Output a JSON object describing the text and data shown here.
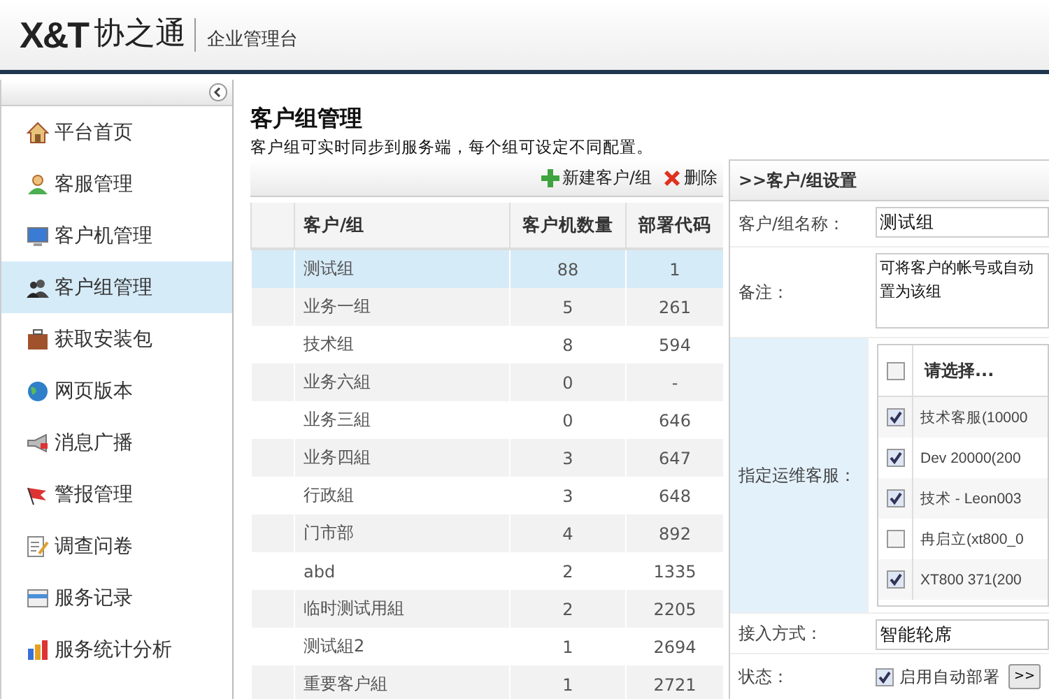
{
  "header": {
    "logo": "X&T",
    "logo_cn": "协之通",
    "subtitle": "企业管理台"
  },
  "sidebar": {
    "items": [
      {
        "label": "平台首页",
        "selected": false
      },
      {
        "label": "客服管理",
        "selected": false
      },
      {
        "label": "客户机管理",
        "selected": false
      },
      {
        "label": "客户组管理",
        "selected": true
      },
      {
        "label": "获取安装包",
        "selected": false
      },
      {
        "label": "网页版本",
        "selected": false
      },
      {
        "label": "消息广播",
        "selected": false
      },
      {
        "label": "警报管理",
        "selected": false
      },
      {
        "label": "调查问卷",
        "selected": false
      },
      {
        "label": "服务记录",
        "selected": false
      },
      {
        "label": "服务统计分析",
        "selected": false
      }
    ]
  },
  "main": {
    "title": "客户组管理",
    "description": "客户组可实时同步到服务端，每个组可设定不同配置。",
    "toolbar": [
      {
        "kind": "add",
        "label": "新建客户/组"
      },
      {
        "kind": "delete",
        "label": "删除"
      }
    ],
    "table": {
      "columns": [
        "客户/组",
        "客户机数量",
        "部署代码"
      ],
      "rows": [
        {
          "cells": [
            "测试组",
            "88",
            "1"
          ],
          "selected": true
        },
        {
          "cells": [
            "业务一组",
            "5",
            "261"
          ],
          "selected": false
        },
        {
          "cells": [
            "技术组",
            "8",
            "594"
          ],
          "selected": false
        },
        {
          "cells": [
            "业务六組",
            "0",
            "-"
          ],
          "selected": false
        },
        {
          "cells": [
            "业务三組",
            "0",
            "646"
          ],
          "selected": false
        },
        {
          "cells": [
            "业务四組",
            "3",
            "647"
          ],
          "selected": false
        },
        {
          "cells": [
            "行政組",
            "3",
            "648"
          ],
          "selected": false
        },
        {
          "cells": [
            "门市部",
            "4",
            "892"
          ],
          "selected": false
        },
        {
          "cells": [
            "abd",
            "2",
            "1335"
          ],
          "selected": false
        },
        {
          "cells": [
            "临时测试用組",
            "2",
            "2205"
          ],
          "selected": false
        },
        {
          "cells": [
            "测试組2",
            "1",
            "2694"
          ],
          "selected": false
        },
        {
          "cells": [
            "重要客户組",
            "1",
            "2721"
          ],
          "selected": false
        }
      ]
    }
  },
  "settings": {
    "title": ">>客户/组设置",
    "name_label": "客户/组名称：",
    "name_value": "测试组",
    "remark_label": "备注：",
    "remark_lines": [
      "可将客户的帐号或自动",
      "置为该组"
    ],
    "assign_label": "指定运维客服：",
    "select_all": {
      "label": "请选择...",
      "checked": false
    },
    "agents": [
      {
        "label": "技术客服(10000",
        "checked": true
      },
      {
        "label": "Dev 20000(200",
        "checked": true
      },
      {
        "label": "技术 - Leon003",
        "checked": true
      },
      {
        "label": "冉启立(xt800_0",
        "checked": false
      },
      {
        "label": "XT800 371(200",
        "checked": true
      }
    ],
    "access_label": "接入方式：",
    "access_value": "智能轮席",
    "status_label": "状态：",
    "auto_deploy": {
      "label": "启用自动部署",
      "checked": true
    },
    "more_button": ">>"
  }
}
